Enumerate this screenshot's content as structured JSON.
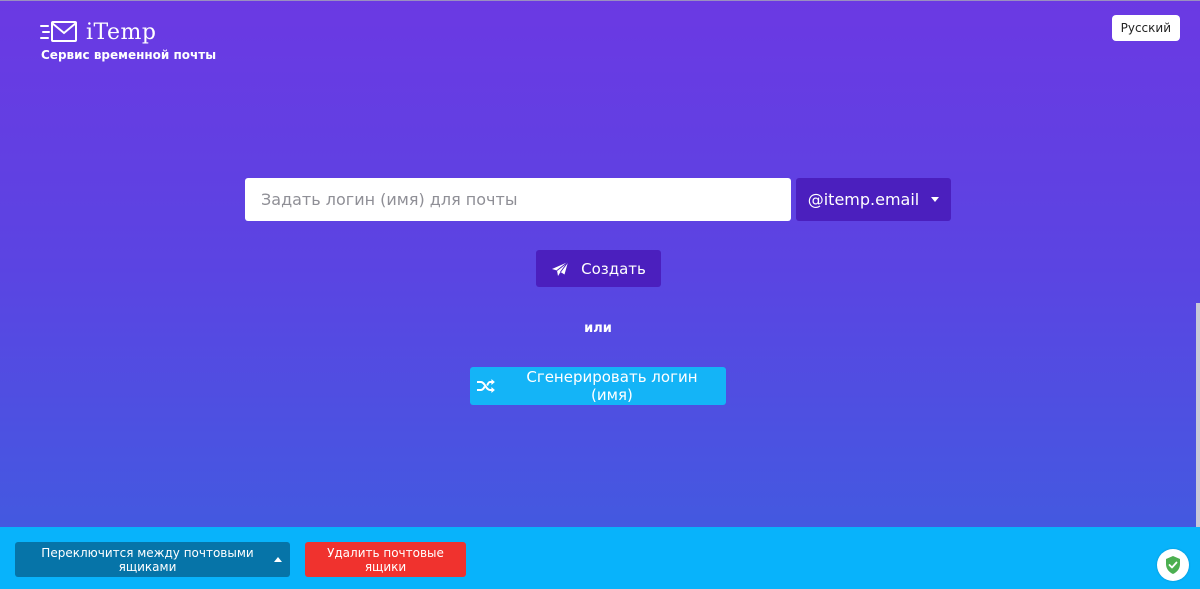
{
  "header": {
    "logo_text": "iTemp",
    "tagline": "Сервис временной почты",
    "language_label": "Русский"
  },
  "form": {
    "login_placeholder": "Задать логин (имя) для почты",
    "login_value": "",
    "domain_label": "@itemp.email",
    "create_label": "Создать",
    "or_text": "или",
    "generate_label": "Сгенерировать логин (имя)"
  },
  "footer": {
    "switch_label": "Переключится между почтовыми ящиками",
    "delete_label": "Удалить почтовые ящики"
  },
  "icons": {
    "logo": "envelope-speed-icon",
    "create": "paper-plane-icon",
    "generate": "shuffle-icon",
    "security": "shield-check-icon"
  },
  "colors": {
    "gradient_top": "#6b39e3",
    "gradient_bottom": "#3e5ee0",
    "primary_button": "#4b1fbe",
    "generate_button": "#14b4f7",
    "footer_bg": "#08b3fb",
    "switch_button": "#0674a8",
    "delete_button": "#f0322e",
    "shield_green": "#4caf50"
  }
}
